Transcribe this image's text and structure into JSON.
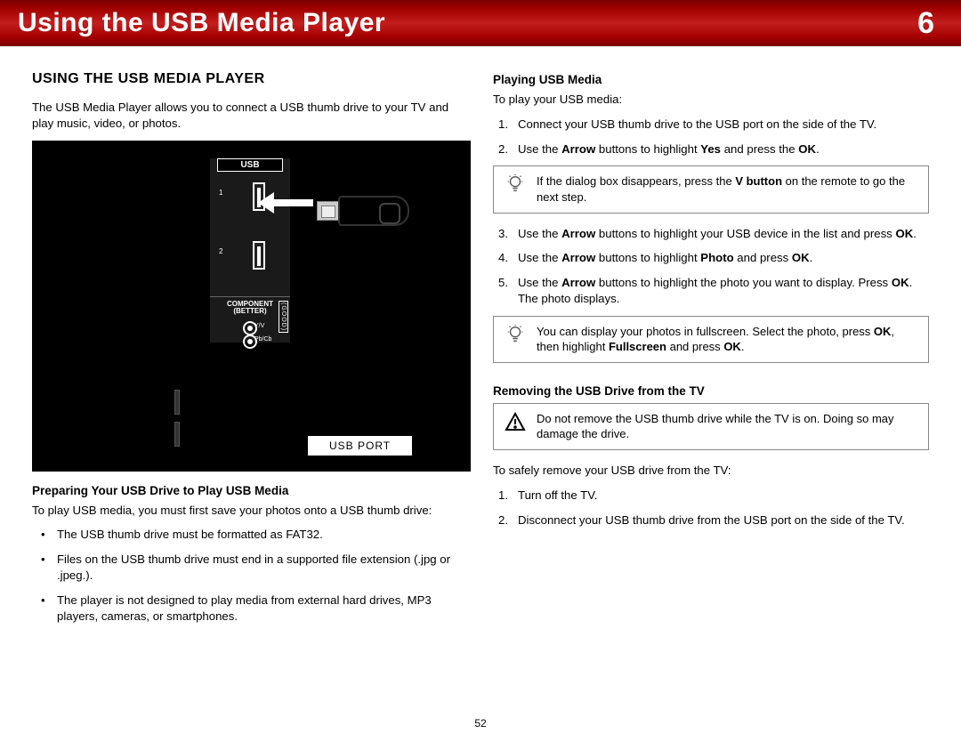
{
  "header": {
    "title": "Using the USB Media Player",
    "chapter": "6"
  },
  "page_number": "52",
  "left": {
    "section_title": "USING THE USB MEDIA PLAYER",
    "intro": "The USB Media Player allows you to connect a USB thumb drive to your TV and play music, video, or photos.",
    "illus": {
      "usb_label": "USB",
      "slot1": "1",
      "slot2": "2",
      "component": "COMPONENT",
      "better": "(BETTER)",
      "yv": "Y/V",
      "pbcb": "Pb/Cb",
      "good": "(GOOD)",
      "port_tag": "USB PORT"
    },
    "prep_title": "Preparing Your USB Drive to Play USB Media",
    "prep_intro": "To play USB media, you must first save your photos onto a USB thumb drive:",
    "prep_items": [
      "The USB thumb drive must be formatted as FAT32.",
      "Files on the USB thumb drive must end in a supported file extension (.jpg or .jpeg.).",
      "The player is not designed to play media from external hard drives, MP3 players, cameras, or smartphones."
    ]
  },
  "right": {
    "play_title": "Playing USB Media",
    "play_intro": "To play your USB media:",
    "step1": "Connect your USB thumb drive to the USB port on the side of the TV.",
    "step2_pre": "Use the ",
    "step2_arrow": "Arrow",
    "step2_mid": " buttons to highlight ",
    "step2_yes": "Yes",
    "step2_mid2": " and press the ",
    "step2_ok": "OK",
    "step2_end": ".",
    "tip1_a": "If the dialog box disappears, press the ",
    "tip1_b": "V button",
    "tip1_c": " on the remote to go the next step.",
    "step3_a": "Use the ",
    "step3_b": "Arrow",
    "step3_c": " buttons to highlight your USB device in the list and press ",
    "step3_d": "OK",
    "step3_e": ".",
    "step4_a": "Use the ",
    "step4_b": "Arrow",
    "step4_c": " buttons to highlight ",
    "step4_d": "Photo",
    "step4_e": " and press ",
    "step4_f": "OK",
    "step4_g": ".",
    "step5_a": "Use the ",
    "step5_b": "Arrow",
    "step5_c": " buttons to highlight the photo you want to display. Press ",
    "step5_d": "OK",
    "step5_e": ". The photo displays.",
    "tip2_a": "You can display your photos in fullscreen. Select the photo, press ",
    "tip2_b": "OK",
    "tip2_c": ", then highlight ",
    "tip2_d": "Fullscreen",
    "tip2_e": " and press ",
    "tip2_f": "OK",
    "tip2_g": ".",
    "remove_title": "Removing the USB Drive from the TV",
    "warn": "Do not remove the USB thumb drive while the TV is on. Doing so may damage the drive.",
    "remove_intro": "To safely remove your USB drive from the TV:",
    "rstep1": "Turn off the TV.",
    "rstep2": "Disconnect your USB thumb drive from the USB port on the side of the TV."
  }
}
